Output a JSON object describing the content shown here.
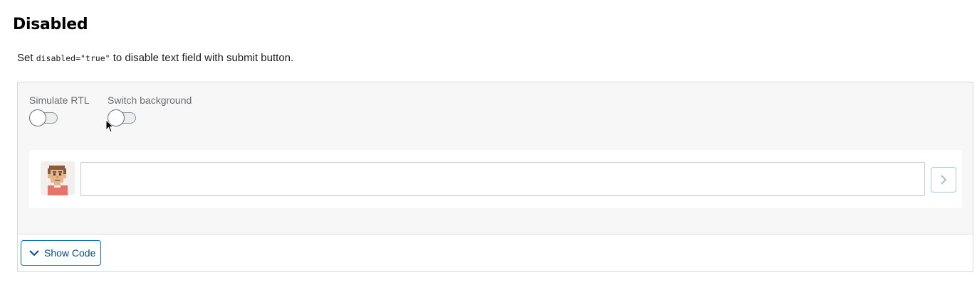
{
  "page": {
    "heading": "Disabled",
    "description": {
      "prefix": "Set ",
      "code": "disabled=\"true\"",
      "suffix": " to disable text field with submit button."
    }
  },
  "toolbar": {
    "switches": [
      {
        "label": "Simulate RTL",
        "checked": false
      },
      {
        "label": "Switch background",
        "checked": false
      }
    ]
  },
  "feed_input": {
    "value": "",
    "disabled": true,
    "submit_icon": "chevron-right-icon",
    "avatar_icon": "pixel-avatar-icon"
  },
  "footer": {
    "show_code_label": "Show Code",
    "show_code_icon": "chevron-down-icon"
  },
  "colors": {
    "brand": "#0a6ed1",
    "stage_background": "#f7f7f8",
    "border": "#d9d9d9"
  }
}
